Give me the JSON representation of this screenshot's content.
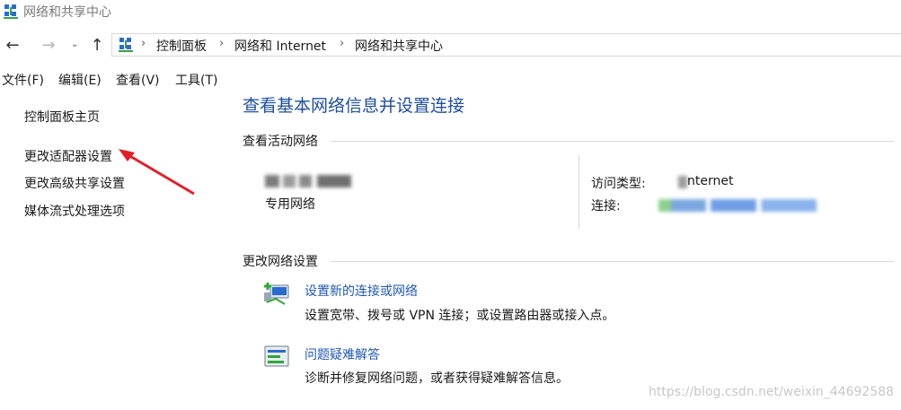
{
  "window": {
    "title": "网络和共享中心"
  },
  "address": {
    "crumbs": [
      "控制面板",
      "网络和 Internet",
      "网络和共享中心"
    ],
    "separator": "›"
  },
  "nav": {
    "back": "←",
    "forward": "→",
    "dropdown": "⌄",
    "up": "↑"
  },
  "menu": {
    "items": [
      "文件(F)",
      "编辑(E)",
      "查看(V)",
      "工具(T)"
    ]
  },
  "sidebar": {
    "items": [
      "控制面板主页",
      "更改适配器设置",
      "更改高级共享设置",
      "媒体流式处理选项"
    ]
  },
  "main": {
    "heading": "查看基本网络信息并设置连接",
    "active_networks": {
      "label": "查看活动网络",
      "network_type": "专用网络",
      "access_type_label": "访问类型:",
      "access_type_value": "nternet",
      "connection_label": "连接:"
    },
    "change_settings": {
      "label": "更改网络设置",
      "actions": [
        {
          "title": "设置新的连接或网络",
          "description": "设置宽带、拨号或 VPN 连接；或设置路由器或接入点。",
          "icon": "new-connection-icon"
        },
        {
          "title": "问题疑难解答",
          "description": "诊断并修复网络问题，或者获得疑难解答信息。",
          "icon": "troubleshoot-icon"
        }
      ]
    }
  },
  "watermark": "https://blog.csdn.net/weixin_44692588",
  "colors": {
    "heading": "#1e4fa0",
    "link": "#1e58b8",
    "arrow": "#e0202a"
  }
}
